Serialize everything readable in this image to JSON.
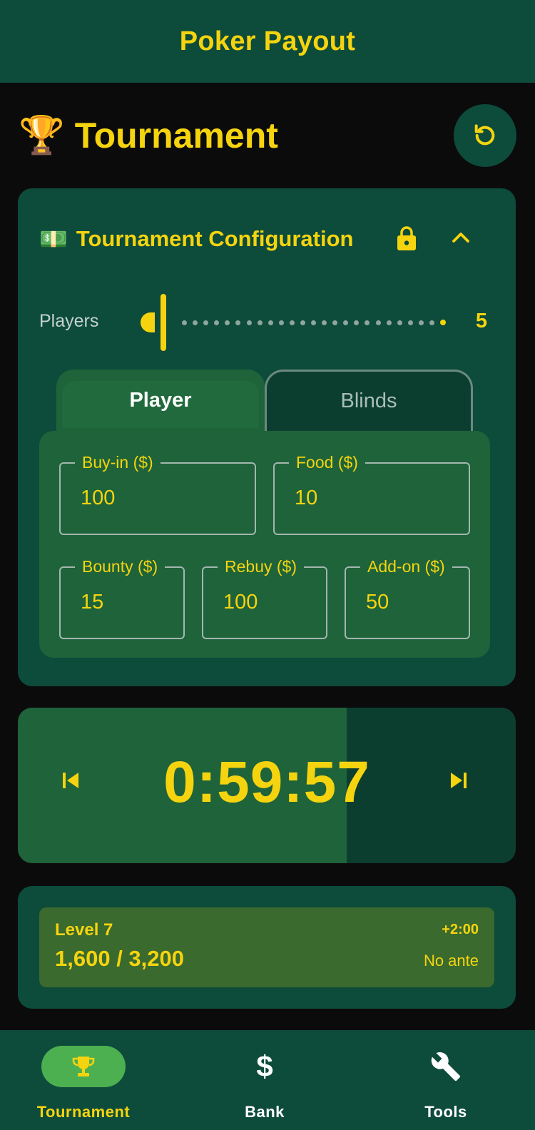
{
  "app": {
    "title": "Poker Payout"
  },
  "header": {
    "title": "Tournament",
    "trophy_emoji": "🏆",
    "reset_icon": "refresh-icon"
  },
  "config": {
    "money_emoji": "💵",
    "title": "Tournament Configuration",
    "lock_icon": "lock-icon",
    "collapse_icon": "chevron-up-icon",
    "players": {
      "label": "Players",
      "value": "5"
    },
    "tabs": [
      {
        "label": "Player",
        "selected": true
      },
      {
        "label": "Blinds",
        "selected": false
      }
    ],
    "fields": {
      "buyin": {
        "label": "Buy-in ($)",
        "value": "100"
      },
      "food": {
        "label": "Food ($)",
        "value": "10"
      },
      "bounty": {
        "label": "Bounty ($)",
        "value": "15"
      },
      "rebuy": {
        "label": "Rebuy ($)",
        "value": "100"
      },
      "addon": {
        "label": "Add-on ($)",
        "value": "50"
      }
    }
  },
  "timer": {
    "time": "0:59:57",
    "level_progress_fraction": 0.66,
    "prev_icon": "skip-previous-icon",
    "next_icon": "skip-next-icon"
  },
  "level": {
    "label": "Level 7",
    "blinds": "1,600 / 3,200",
    "time_added": "+2:00",
    "ante": "No ante"
  },
  "nav": {
    "items": [
      {
        "label": "Tournament",
        "icon": "trophy-icon",
        "active": true
      },
      {
        "label": "Bank",
        "icon": "dollar-icon",
        "active": false,
        "glyph": "$"
      },
      {
        "label": "Tools",
        "icon": "wrench-icon",
        "active": false
      }
    ]
  },
  "colors": {
    "accent": "#f5d40f",
    "header_bg": "#0d4b3b",
    "panel_green": "#1e633a",
    "background": "#0b0b0b"
  }
}
